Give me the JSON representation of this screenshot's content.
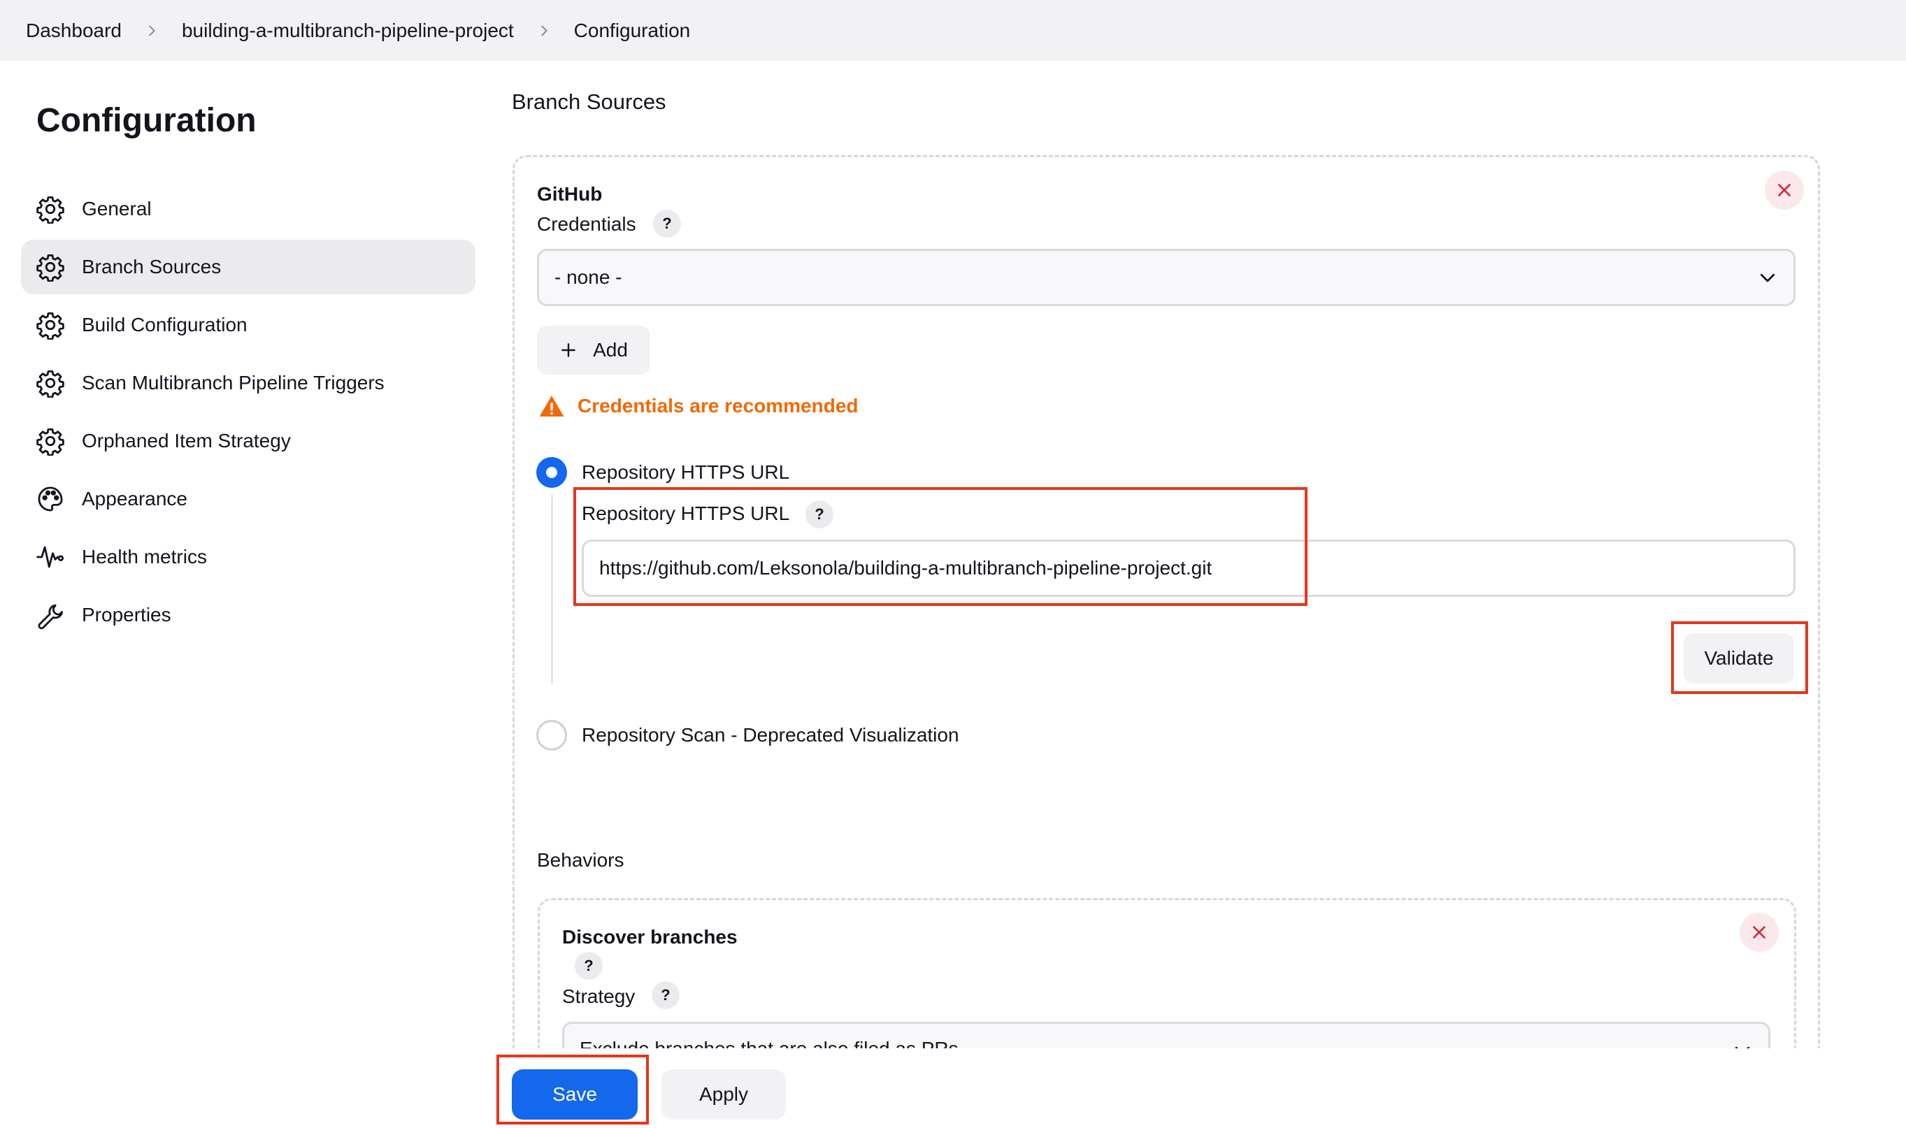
{
  "breadcrumb": {
    "items": [
      "Dashboard",
      "building-a-multibranch-pipeline-project",
      "Configuration"
    ]
  },
  "sidebar": {
    "title": "Configuration",
    "items": [
      {
        "label": "General",
        "icon": "gear-icon"
      },
      {
        "label": "Branch Sources",
        "icon": "gear-icon",
        "active": true
      },
      {
        "label": "Build Configuration",
        "icon": "gear-icon"
      },
      {
        "label": "Scan Multibranch Pipeline Triggers",
        "icon": "gear-icon"
      },
      {
        "label": "Orphaned Item Strategy",
        "icon": "gear-icon"
      },
      {
        "label": "Appearance",
        "icon": "palette-icon"
      },
      {
        "label": "Health metrics",
        "icon": "pulse-icon"
      },
      {
        "label": "Properties",
        "icon": "wrench-icon"
      }
    ]
  },
  "main": {
    "heading": "Branch Sources",
    "github": {
      "title": "GitHub",
      "credentials_label": "Credentials",
      "credentials_value": "- none -",
      "add_label": "Add",
      "warning": "Credentials are recommended",
      "radio_https_label": "Repository HTTPS URL",
      "url_field_label": "Repository HTTPS URL",
      "url_value": "https://github.com/Leksonola/building-a-multibranch-pipeline-project.git",
      "validate_label": "Validate",
      "radio_scan_label": "Repository Scan - Deprecated Visualization",
      "help_symbol": "?"
    },
    "behaviors": {
      "heading": "Behaviors",
      "discover_title": "Discover branches",
      "strategy_label": "Strategy",
      "strategy_value": "Exclude branches that are also filed as PRs"
    }
  },
  "footer": {
    "save_label": "Save",
    "apply_label": "Apply"
  },
  "colors": {
    "accent": "#1368ec",
    "warning": "#f06a08",
    "highlight_box": "#e5361d",
    "danger": "#d9263a"
  }
}
